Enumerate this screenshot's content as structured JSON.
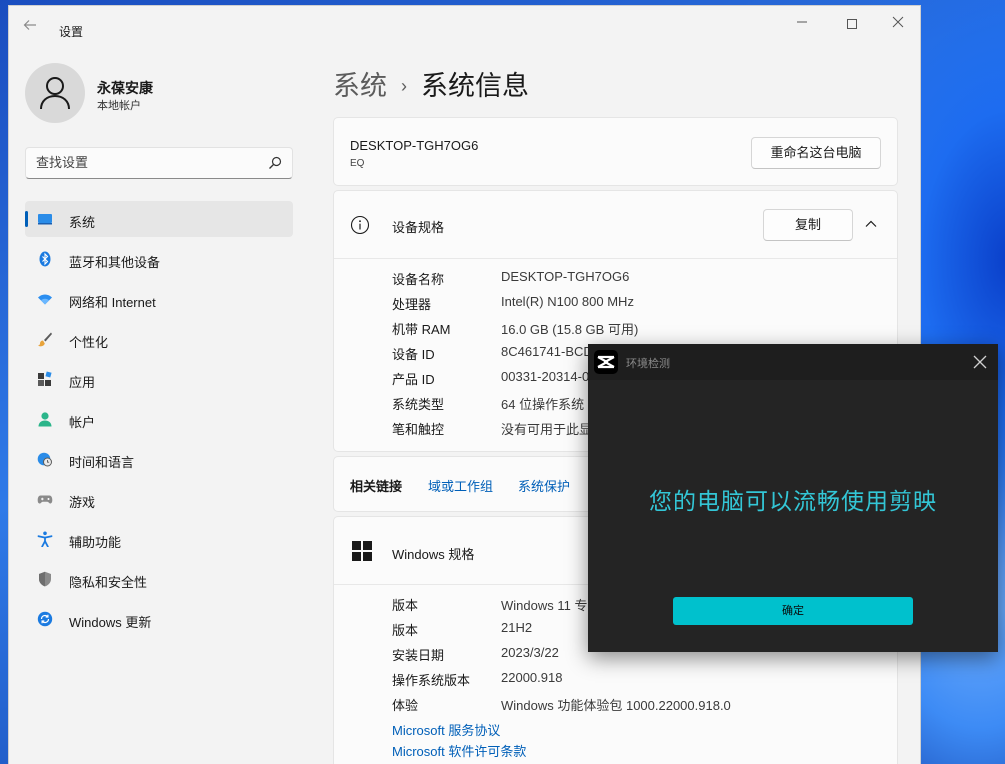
{
  "window": {
    "app_title": "设置"
  },
  "account": {
    "name": "永葆安康",
    "type": "本地帐户"
  },
  "search": {
    "placeholder": "查找设置"
  },
  "sidebar": {
    "items": [
      {
        "label": "系统",
        "icon": "system-icon",
        "active": true
      },
      {
        "label": "蓝牙和其他设备",
        "icon": "bluetooth-icon"
      },
      {
        "label": "网络和 Internet",
        "icon": "wifi-icon"
      },
      {
        "label": "个性化",
        "icon": "brush-icon"
      },
      {
        "label": "应用",
        "icon": "apps-icon"
      },
      {
        "label": "帐户",
        "icon": "account-icon"
      },
      {
        "label": "时间和语言",
        "icon": "globe-clock-icon"
      },
      {
        "label": "游戏",
        "icon": "gamepad-icon"
      },
      {
        "label": "辅助功能",
        "icon": "accessibility-icon"
      },
      {
        "label": "隐私和安全性",
        "icon": "shield-icon"
      },
      {
        "label": "Windows 更新",
        "icon": "update-icon"
      }
    ]
  },
  "breadcrumb": {
    "parent": "系统",
    "separator": "›",
    "current": "系统信息"
  },
  "device": {
    "name": "DESKTOP-TGH7OG6",
    "model": "EQ",
    "rename_label": "重命名这台电脑"
  },
  "device_specs": {
    "title": "设备规格",
    "copy_label": "复制",
    "rows": [
      {
        "key": "设备名称",
        "value": "DESKTOP-TGH7OG6"
      },
      {
        "key": "处理器",
        "value": "Intel(R) N100   800 MHz"
      },
      {
        "key": "机带 RAM",
        "value": "16.0 GB (15.8 GB 可用)"
      },
      {
        "key": "设备 ID",
        "value": "8C461741-BCD"
      },
      {
        "key": "产品 ID",
        "value": "00331-20314-0"
      },
      {
        "key": "系统类型",
        "value": "64 位操作系统"
      },
      {
        "key": "笔和触控",
        "value": "没有可用于此显"
      }
    ]
  },
  "related_links": {
    "label": "相关链接",
    "links": [
      "域或工作组",
      "系统保护"
    ]
  },
  "windows_specs": {
    "title": "Windows 规格",
    "rows": [
      {
        "key": "版本",
        "value": "Windows 11 专"
      },
      {
        "key": "版本",
        "value": "21H2"
      },
      {
        "key": "安装日期",
        "value": "2023/3/22"
      },
      {
        "key": "操作系统版本",
        "value": "22000.918"
      },
      {
        "key": "体验",
        "value": "Windows 功能体验包 1000.22000.918.0"
      }
    ],
    "links": [
      "Microsoft 服务协议",
      "Microsoft 软件许可条款"
    ]
  },
  "dialog": {
    "title": "环境检测",
    "message": "您的电脑可以流畅使用剪映",
    "ok_label": "确定",
    "accent_color": "#00c1cd"
  }
}
